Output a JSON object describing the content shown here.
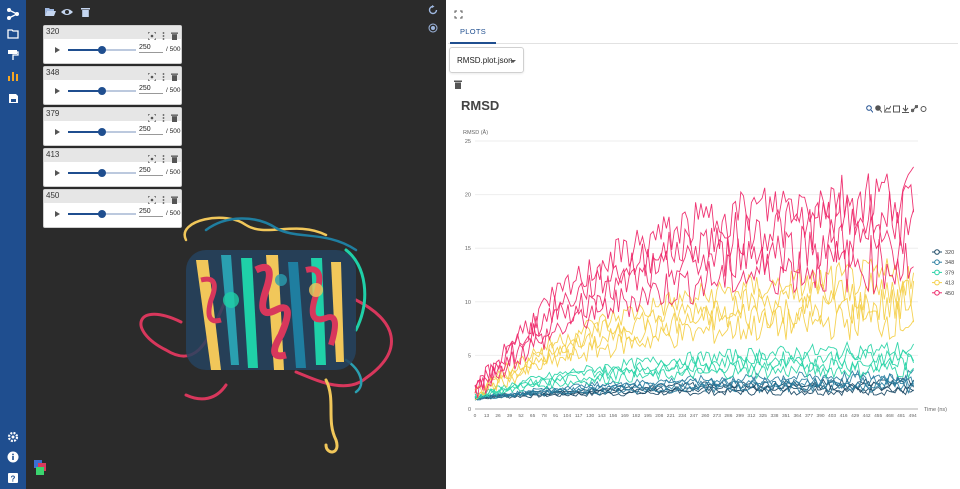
{
  "sidebar": {
    "icons": [
      "share-network-icon",
      "folder-icon",
      "paint-roller-icon",
      "bar-chart-icon",
      "save-icon",
      "settings-gear-icon",
      "info-icon",
      "help-icon"
    ]
  },
  "viewer": {
    "toolbar_icons": [
      "open-folder-icon",
      "eye-icon",
      "trash-icon"
    ],
    "right_icons": [
      "sync-icon",
      "close-circle-icon"
    ],
    "trajectories": [
      {
        "name": "320",
        "frame": "250",
        "total": "/ 500",
        "progress": 0.5
      },
      {
        "name": "348",
        "frame": "250",
        "total": "/ 500",
        "progress": 0.5
      },
      {
        "name": "379",
        "frame": "250",
        "total": "/ 500",
        "progress": 0.5
      },
      {
        "name": "413",
        "frame": "250",
        "total": "/ 500",
        "progress": 0.5
      },
      {
        "name": "450",
        "frame": "250",
        "total": "/ 500",
        "progress": 0.5
      }
    ]
  },
  "plots_panel": {
    "tab_label": "PLOTS",
    "file_selected": "RMSD.plot.json"
  },
  "chart_data": {
    "type": "line",
    "title": "RMSD",
    "ylabel": "RMSD (Å)",
    "xlabel": "Time (ns)",
    "ylim": [
      0,
      25
    ],
    "xlim": [
      0,
      500
    ],
    "yticks": [
      "0",
      "5",
      "10",
      "15",
      "20",
      "25"
    ],
    "xticks": [
      "0",
      "13",
      "26",
      "39",
      "52",
      "65",
      "78",
      "91",
      "104",
      "117",
      "130",
      "143",
      "156",
      "169",
      "182",
      "195",
      "208",
      "221",
      "234",
      "247",
      "260",
      "273",
      "286",
      "299",
      "312",
      "325",
      "338",
      "351",
      "364",
      "377",
      "390",
      "403",
      "416",
      "429",
      "442",
      "455",
      "468",
      "481",
      "494"
    ],
    "grid": true,
    "legend_position": "right",
    "series": [
      {
        "name": "320",
        "color": "#1b4965",
        "start": 1.0,
        "end": 2.5,
        "plateau": 2.2,
        "noise": 0.3
      },
      {
        "name": "348",
        "color": "#2a7ea0",
        "start": 1.0,
        "end": 3.0,
        "plateau": 2.8,
        "noise": 0.4
      },
      {
        "name": "379",
        "color": "#2ad4a8",
        "start": 1.2,
        "end": 5.5,
        "plateau": 5.0,
        "noise": 0.6
      },
      {
        "name": "413",
        "color": "#f4d04a",
        "start": 1.3,
        "end": 13.0,
        "plateau": 11.0,
        "noise": 1.3
      },
      {
        "name": "450",
        "color": "#ee2a6b",
        "start": 1.5,
        "end": 17.5,
        "plateau": 19.5,
        "noise": 2.0
      }
    ]
  }
}
